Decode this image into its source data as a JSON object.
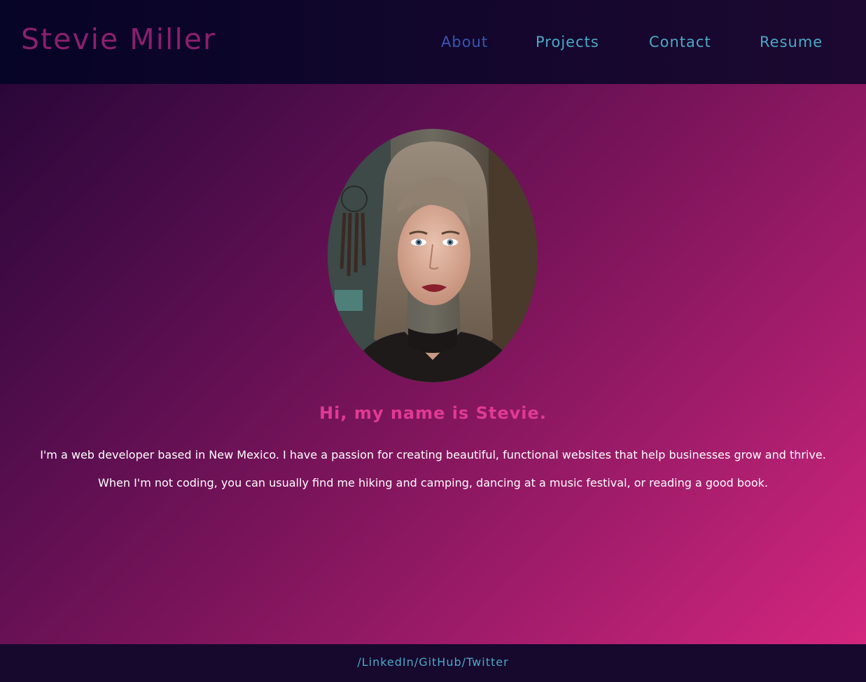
{
  "header": {
    "site_title": "Stevie Miller",
    "nav": [
      {
        "label": "About",
        "active": true
      },
      {
        "label": "Projects",
        "active": false
      },
      {
        "label": "Contact",
        "active": false
      },
      {
        "label": "Resume",
        "active": false
      }
    ]
  },
  "main": {
    "greeting": "Hi, my name is Stevie.",
    "paragraphs": [
      "I'm a web developer based in New Mexico. I have a passion for creating beautiful, functional websites that help businesses grow and thrive.",
      "When I'm not coding, you can usually find me hiking and camping, dancing at a music festival, or reading a good book."
    ]
  },
  "footer": {
    "separator": "/",
    "links": [
      "LinkedIn",
      "GitHub",
      "Twitter"
    ]
  },
  "colors": {
    "title": "#8c1f6e",
    "nav_link": "#4ba9c7",
    "nav_active": "#3956b3",
    "greeting": "#e03a94",
    "footer_bg": "#17082e"
  }
}
